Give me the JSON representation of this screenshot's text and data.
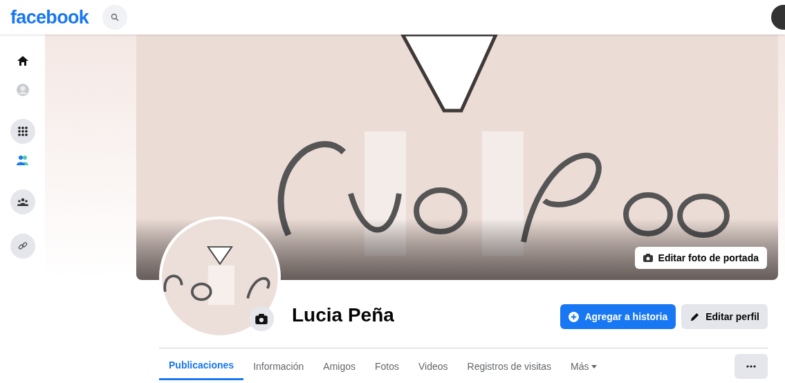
{
  "top_bar": {
    "brand": "facebook"
  },
  "cover": {
    "kind": "picture",
    "edit_button": "Editar foto de portada"
  },
  "profile": {
    "name": "Lucia Peña"
  },
  "actions": [
    {
      "label": "Agregar a historia",
      "kind": "primary"
    },
    {
      "label": "Editar perfil",
      "kind": "secondary"
    }
  ],
  "tabs": [
    {
      "label": "Publicaciones",
      "selected": true
    },
    {
      "label": "Información",
      "selected": false
    },
    {
      "label": "Amigos",
      "selected": false
    },
    {
      "label": "Fotos",
      "selected": false
    },
    {
      "label": "Videos",
      "selected": false
    },
    {
      "label": "Registros de visitas",
      "selected": false
    },
    {
      "label": "Más",
      "selected": false,
      "dropdown": true
    }
  ]
}
